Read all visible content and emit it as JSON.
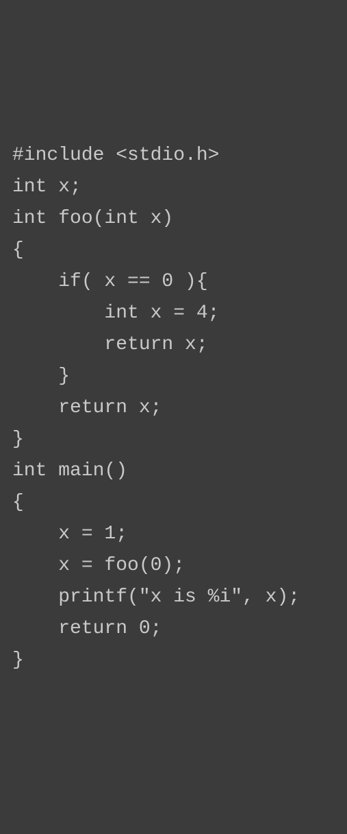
{
  "code": {
    "lines": [
      "#include <stdio.h>",
      "",
      "int x;",
      "int foo(int x)",
      "{",
      "    if( x == 0 ){",
      "        int x = 4;",
      "        return x;",
      "    }",
      "    return x;",
      "}",
      "",
      "int main()",
      "{",
      "    x = 1;",
      "    x = foo(0);",
      "    printf(\"x is %i\", x);",
      "    return 0;",
      "}"
    ]
  }
}
